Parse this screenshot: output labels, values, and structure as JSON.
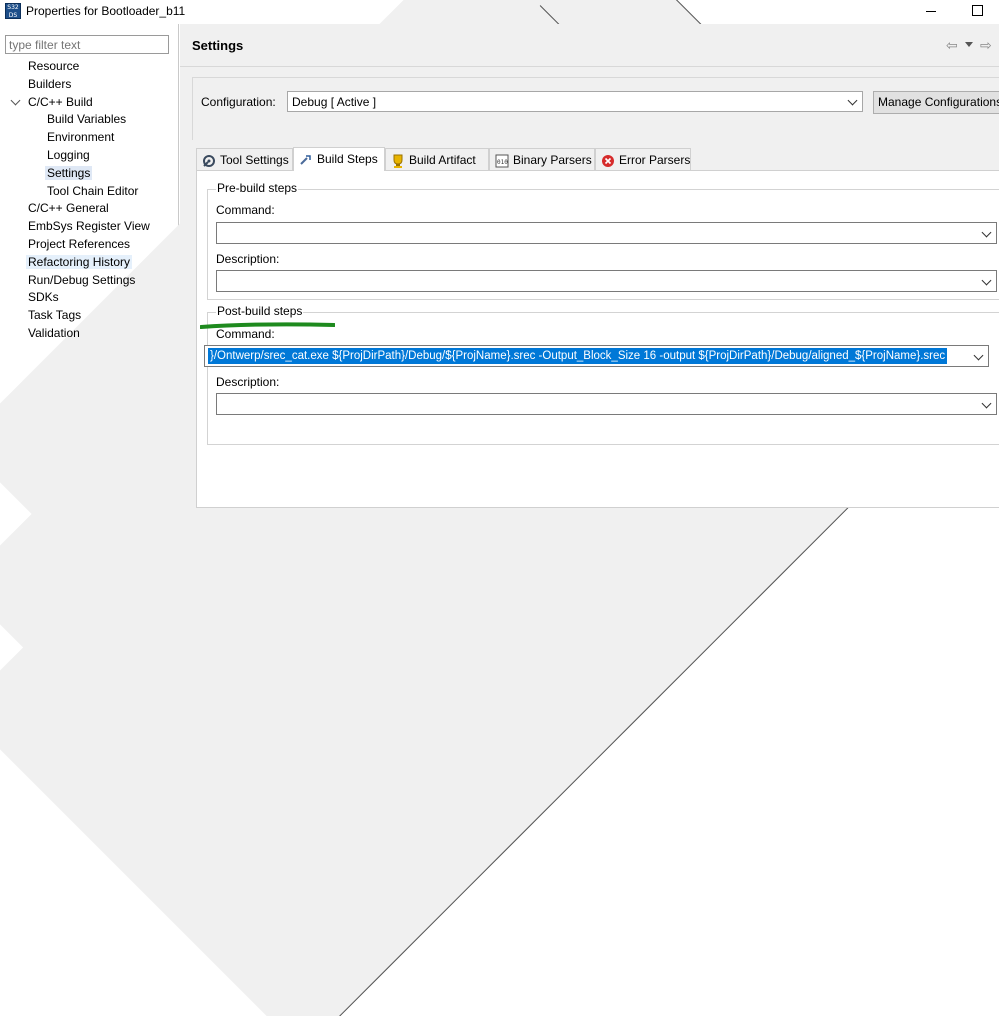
{
  "window": {
    "app_icon_text": "S32\nDS",
    "title": "Properties for Bootloader_b11"
  },
  "left_panel": {
    "filter_placeholder": "type filter text",
    "tree": [
      {
        "label": "Resource",
        "level": 0,
        "expander": "collapsed"
      },
      {
        "label": "Builders",
        "level": 0,
        "expander": "none"
      },
      {
        "label": "C/C++ Build",
        "level": 0,
        "expander": "expanded"
      },
      {
        "label": "Build Variables",
        "level": 1,
        "expander": "none"
      },
      {
        "label": "Environment",
        "level": 1,
        "expander": "none"
      },
      {
        "label": "Logging",
        "level": 1,
        "expander": "none"
      },
      {
        "label": "Settings",
        "level": 1,
        "expander": "none",
        "selected": true
      },
      {
        "label": "Tool Chain Editor",
        "level": 1,
        "expander": "none"
      },
      {
        "label": "C/C++ General",
        "level": 0,
        "expander": "collapsed"
      },
      {
        "label": "EmbSys Register View",
        "level": 0,
        "expander": "none"
      },
      {
        "label": "Project References",
        "level": 0,
        "expander": "none"
      },
      {
        "label": "Refactoring History",
        "level": 0,
        "expander": "none",
        "hover": true
      },
      {
        "label": "Run/Debug Settings",
        "level": 0,
        "expander": "none"
      },
      {
        "label": "SDKs",
        "level": 0,
        "expander": "none"
      },
      {
        "label": "Task Tags",
        "level": 0,
        "expander": "none"
      },
      {
        "label": "Validation",
        "level": 0,
        "expander": "collapsed"
      }
    ]
  },
  "header": {
    "title": "Settings",
    "nav_back_icon": "back-arrow-icon",
    "nav_menu_icon": "dropdown-icon",
    "nav_forward_icon": "forward-arrow-icon"
  },
  "configuration": {
    "label": "Configuration:",
    "value": "Debug  [ Active ]",
    "manage_button": "Manage Configurations..."
  },
  "tabs": [
    {
      "label": "Tool Settings",
      "icon": "tool-settings-icon"
    },
    {
      "label": "Build Steps",
      "icon": "build-steps-icon",
      "active": true
    },
    {
      "label": "Build Artifact",
      "icon": "build-artifact-icon"
    },
    {
      "label": "Binary Parsers",
      "icon": "binary-parsers-icon"
    },
    {
      "label": "Error Parsers",
      "icon": "error-parsers-icon"
    }
  ],
  "pre_build": {
    "title": "Pre-build steps",
    "command_label": "Command:",
    "command_value": "",
    "description_label": "Description:",
    "description_value": ""
  },
  "post_build": {
    "title": "Post-build steps",
    "command_label": "Command:",
    "command_value": "}/Ontwerp/srec_cat.exe ${ProjDirPath}/Debug/${ProjName}.srec -Output_Block_Size 16 -output ${ProjDirPath}/Debug/aligned_${ProjName}.srec",
    "description_label": "Description:",
    "description_value": ""
  },
  "colors": {
    "selection": "#0078d7",
    "annotation_underline": "#1e8a1e"
  }
}
